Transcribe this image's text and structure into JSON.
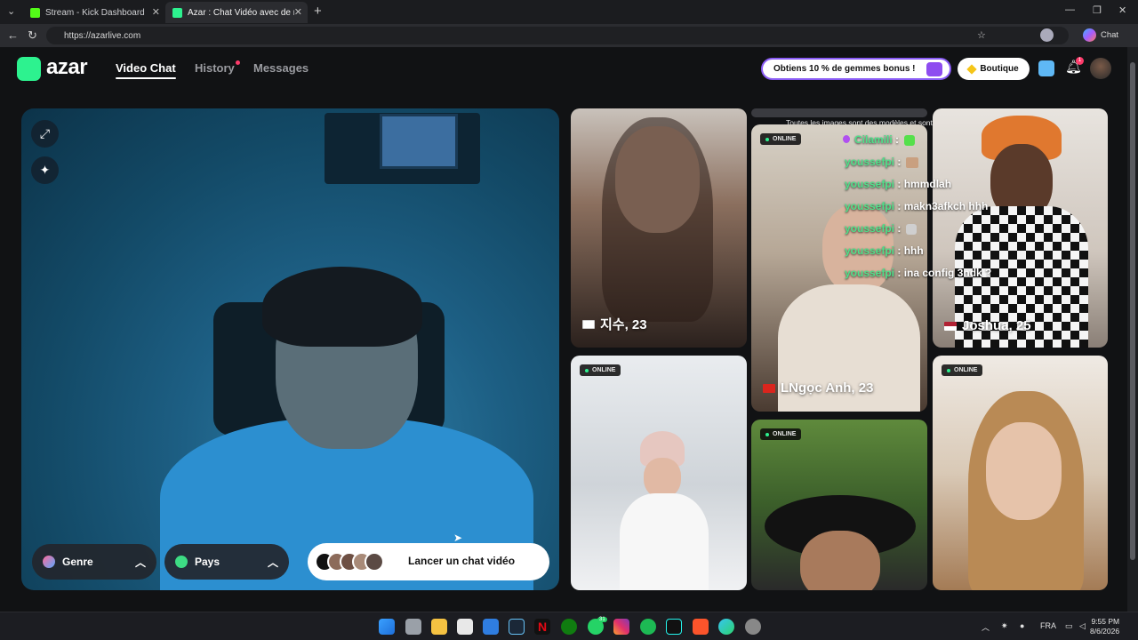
{
  "browser": {
    "tabs": [
      {
        "label": "Stream - Kick Dashboard",
        "icon": "kick-favicon-icon",
        "color": "#53fc18"
      },
      {
        "label": "Azar : Chat Vidéo avec de no",
        "icon": "azar-favicon-icon",
        "color": "#2df28f"
      }
    ],
    "new_tab": "+",
    "url": "https://azarlive.com",
    "chat_label": "Chat"
  },
  "header": {
    "logo": "azar",
    "nav": [
      {
        "label": "Video Chat",
        "active": true
      },
      {
        "label": "History",
        "active": false,
        "dot": true
      },
      {
        "label": "Messages",
        "active": false
      }
    ],
    "promo": "Obtiens 10 % de gemmes bonus !",
    "boutique": "Boutique",
    "notification_count": "1"
  },
  "video": {
    "filters": [
      {
        "label": "Genre",
        "icon": "gender-icon"
      },
      {
        "label": "Pays",
        "icon": "globe-icon"
      }
    ],
    "start_label": "Lancer un chat vidéo"
  },
  "grid": {
    "disclaimer": "Toutes les images sont des modèles et sont utilisées à des fins d'illustration uniquement.",
    "online_label": "ONLINE",
    "cards": [
      {
        "name": "지수, 23",
        "flag": "kr"
      },
      {
        "name": "LNgọc Anh, 23",
        "flag": "vn"
      },
      {
        "name": "Joshua, 25",
        "flag": "us"
      }
    ],
    "chat_overlay": [
      {
        "user": "Cilamili",
        "text": ":"
      },
      {
        "user": "youssefpi",
        "text": ":"
      },
      {
        "user": "youssefpi",
        "text": ": hmmdlah"
      },
      {
        "user": "youssefpi",
        "text": ": makn3afkch hhh"
      },
      {
        "user": "youssefpi",
        "text": ":"
      },
      {
        "user": "youssefpi",
        "text": ": hhh"
      },
      {
        "user": "youssefpi",
        "text": ": ina config 3ndk ?"
      }
    ]
  },
  "taskbar": {
    "lang": "FRA",
    "time": "9:55 PM",
    "date": "8/6/2026",
    "badge": "31"
  },
  "colors": {
    "brand": "#2df28f",
    "background": "#111214",
    "promo_border": "#8a5cf5"
  }
}
